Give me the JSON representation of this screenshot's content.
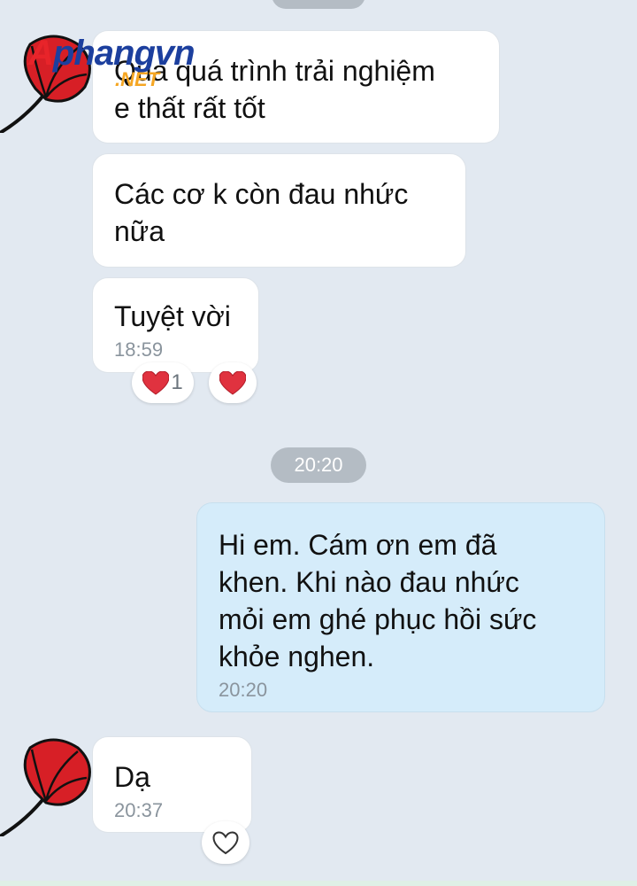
{
  "watermark": {
    "brand_text": "Aphangvn",
    "suffix_text": ".NET"
  },
  "messages": [
    {
      "direction": "received",
      "text": "Qua quá trình trải nghiệm\ne thất rất tốt"
    },
    {
      "direction": "received",
      "text": "Các cơ k còn đau nhức\nnữa"
    },
    {
      "direction": "received",
      "text": "Tuyệt vời",
      "time": "18:59",
      "reactions": [
        {
          "icon": "heart-icon",
          "count": "1"
        },
        {
          "icon": "heart-icon"
        }
      ]
    },
    {
      "direction": "sent",
      "text": "Hi em. Cám ơn em đã\nkhen. Khi nào đau nhức\nmỏi em ghé phục hồi sức\nkhỏe nghen.",
      "time": "20:20"
    },
    {
      "direction": "received",
      "text": "Dạ",
      "time": "20:37",
      "reactions": [
        {
          "icon": "heart-outline-icon"
        }
      ]
    }
  ],
  "date_separator": "20:20",
  "colors": {
    "background": "#e2e9f1",
    "received_bubble": "#ffffff",
    "sent_bubble": "#d5ecfa",
    "pill": "#b4bcc4",
    "heart": "#e0323f",
    "logo_red": "#e8242a",
    "logo_blue": "#1c3f9e",
    "logo_orange": "#f5a623"
  }
}
